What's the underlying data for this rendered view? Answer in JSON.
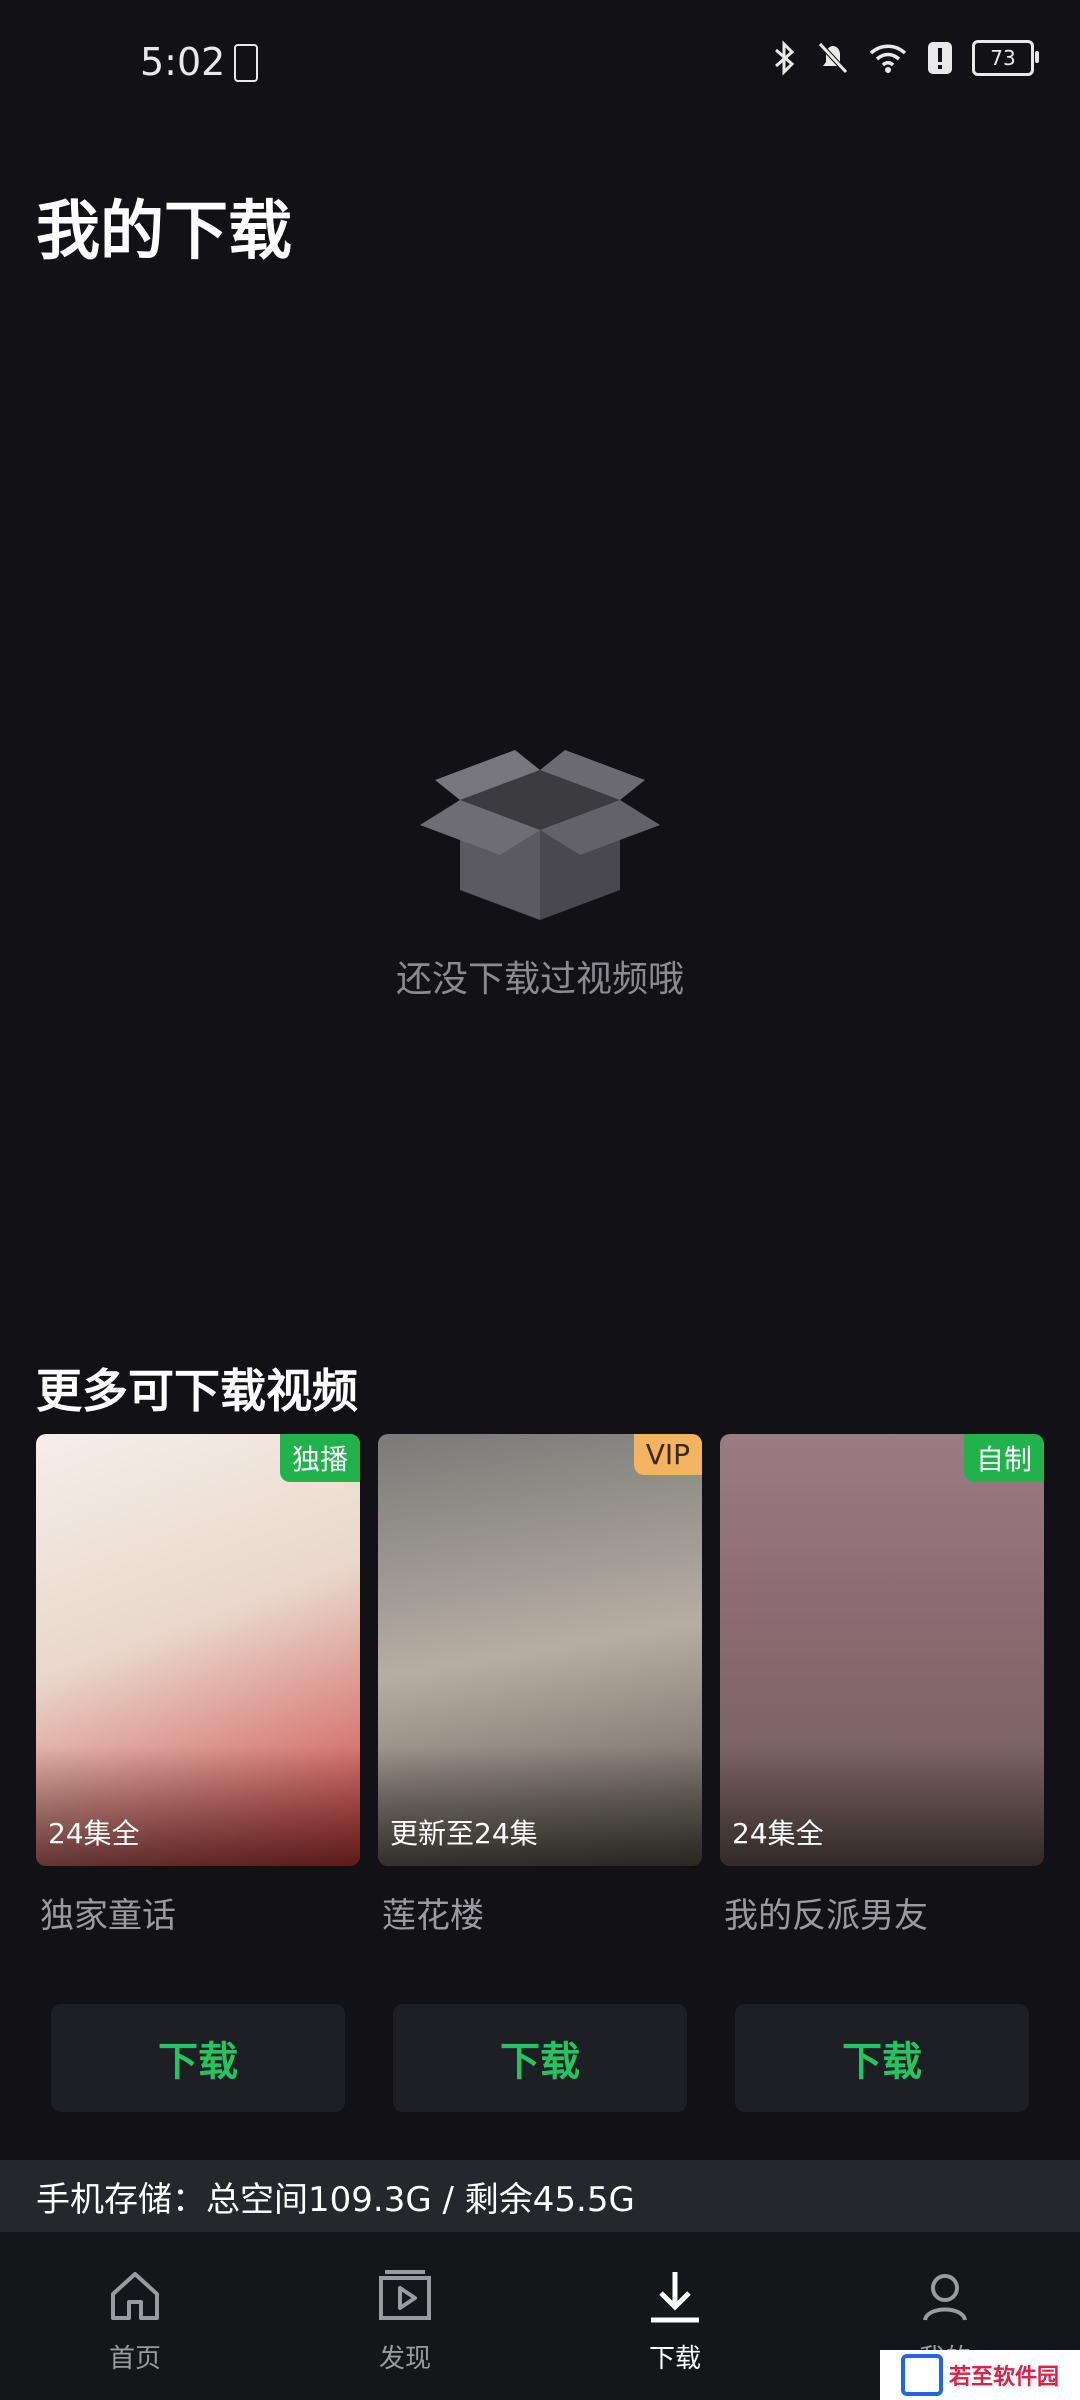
{
  "status_bar": {
    "time": "5:02",
    "battery_level": "73"
  },
  "page": {
    "title": "我的下载"
  },
  "empty_state": {
    "icon": "empty-box-icon",
    "message": "还没下载过视频哦"
  },
  "recommend": {
    "title": "更多可下载视频",
    "items": [
      {
        "title": "独家童话",
        "badge": "独播",
        "badge_color": "#22b24c",
        "meta": "24集全",
        "download_label": "下载"
      },
      {
        "title": "莲花楼",
        "badge": "VIP",
        "badge_color": "#f2b461",
        "meta": "更新至24集",
        "download_label": "下载"
      },
      {
        "title": "我的反派男友",
        "badge": "自制",
        "badge_color": "#22b24c",
        "meta": "24集全",
        "download_label": "下载"
      }
    ]
  },
  "storage": {
    "text": "手机存储：总空间109.3G / 剩余45.5G"
  },
  "bottom_nav": {
    "items": [
      {
        "label": "首页",
        "icon": "home-icon"
      },
      {
        "label": "发现",
        "icon": "discover-icon"
      },
      {
        "label": "下载",
        "icon": "download-icon",
        "active": true
      },
      {
        "label": "我的",
        "icon": "profile-icon"
      }
    ]
  },
  "watermark": {
    "text": "若至软件园"
  },
  "colors": {
    "background": "#121216",
    "accent": "#22c55e",
    "badge_vip": "#f2b461",
    "badge_green": "#22b24c"
  }
}
